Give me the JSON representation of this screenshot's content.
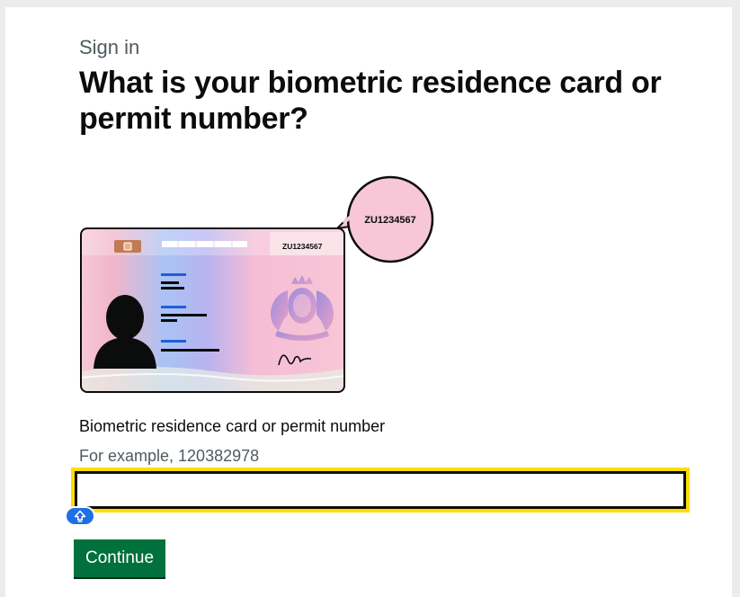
{
  "header": {
    "caption": "Sign in",
    "title": "What is your biometric residence card or permit number?"
  },
  "illustration": {
    "card_number": "ZU1234567",
    "magnified_number": "ZU1234567"
  },
  "form": {
    "label": "Biometric residence card or permit number",
    "hint": "For example, 120382978",
    "value": "",
    "continue_label": "Continue"
  },
  "colors": {
    "focus": "#ffdd00",
    "button": "#00703c",
    "autofill_badge": "#1f6fe5"
  }
}
